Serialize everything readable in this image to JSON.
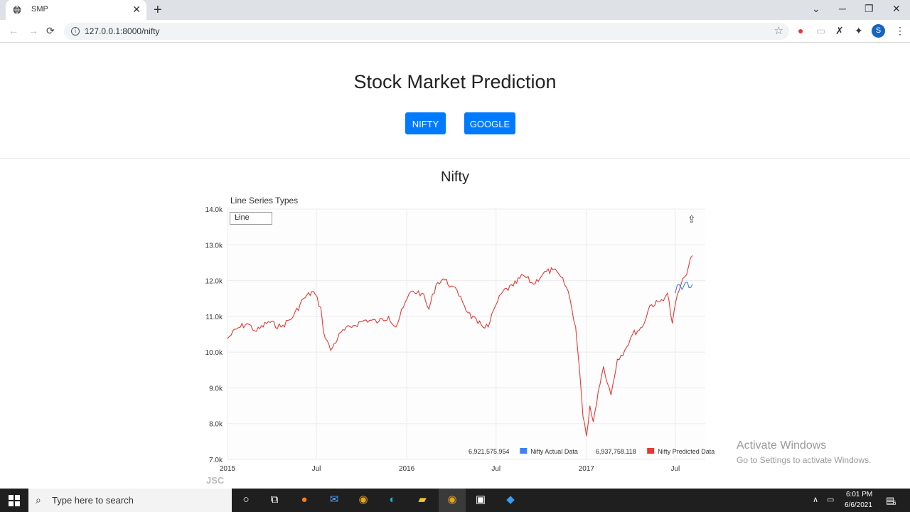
{
  "browser": {
    "tab_title": "SMP",
    "url": "127.0.0.1:8000/nifty",
    "profile_initial": "S"
  },
  "page": {
    "title": "Stock Market Prediction",
    "buttons": [
      "NIFTY",
      "GOOGLE"
    ]
  },
  "chart_controls": {
    "series_types_label": "Line Series Types",
    "series_type_value": "Line",
    "watermark": "JSC"
  },
  "chart_data": {
    "type": "line",
    "title": "Nifty",
    "xlabel": "",
    "ylabel": "",
    "x_range": [
      "2015-01-01",
      "2017-08-31"
    ],
    "ylim": [
      7000,
      14000
    ],
    "y_ticks": [
      "14.0k",
      "13.0k",
      "12.0k",
      "11.0k",
      "10.0k",
      "9.0k",
      "8.0k",
      "7.0k"
    ],
    "x_ticks": [
      {
        "date": "2015-01-01",
        "label": "2015"
      },
      {
        "date": "2015-07-01",
        "label": "Jul"
      },
      {
        "date": "2016-01-01",
        "label": "2016"
      },
      {
        "date": "2016-07-01",
        "label": "Jul"
      },
      {
        "date": "2017-01-01",
        "label": "2017"
      },
      {
        "date": "2017-07-01",
        "label": "Jul"
      }
    ],
    "grid": true,
    "legend_position": "bottom-right",
    "series": [
      {
        "name": "Nifty Predicted Data",
        "legend_value": "6,937,758.118",
        "color": "#e53935",
        "points": [
          [
            "2015-01-01",
            10380
          ],
          [
            "2015-01-20",
            10650
          ],
          [
            "2015-02-10",
            10800
          ],
          [
            "2015-03-01",
            10580
          ],
          [
            "2015-03-25",
            10850
          ],
          [
            "2015-04-20",
            10700
          ],
          [
            "2015-05-15",
            11000
          ],
          [
            "2015-06-05",
            11500
          ],
          [
            "2015-06-25",
            11700
          ],
          [
            "2015-07-10",
            11250
          ],
          [
            "2015-07-15",
            10600
          ],
          [
            "2015-07-30",
            10050
          ],
          [
            "2015-08-20",
            10550
          ],
          [
            "2015-09-15",
            10750
          ],
          [
            "2015-10-10",
            10900
          ],
          [
            "2015-11-05",
            10850
          ],
          [
            "2015-11-25",
            11000
          ],
          [
            "2015-12-10",
            10700
          ],
          [
            "2015-12-25",
            11250
          ],
          [
            "2016-01-10",
            11700
          ],
          [
            "2016-02-01",
            11650
          ],
          [
            "2016-02-15",
            11200
          ],
          [
            "2016-03-01",
            11900
          ],
          [
            "2016-03-15",
            12050
          ],
          [
            "2016-04-01",
            11850
          ],
          [
            "2016-04-20",
            11550
          ],
          [
            "2016-05-05",
            11100
          ],
          [
            "2016-05-25",
            10800
          ],
          [
            "2016-06-15",
            10700
          ],
          [
            "2016-06-30",
            11300
          ],
          [
            "2016-07-15",
            11700
          ],
          [
            "2016-08-05",
            11850
          ],
          [
            "2016-08-25",
            12150
          ],
          [
            "2016-09-15",
            11900
          ],
          [
            "2016-10-05",
            12200
          ],
          [
            "2016-10-25",
            12300
          ],
          [
            "2016-11-10",
            12100
          ],
          [
            "2016-11-25",
            11700
          ],
          [
            "2016-12-10",
            10700
          ],
          [
            "2016-12-18",
            9500
          ],
          [
            "2016-12-25",
            8200
          ],
          [
            "2017-01-01",
            7650
          ],
          [
            "2017-01-08",
            8500
          ],
          [
            "2017-01-15",
            8050
          ],
          [
            "2017-01-25",
            8900
          ],
          [
            "2017-02-05",
            9600
          ],
          [
            "2017-02-20",
            8800
          ],
          [
            "2017-03-05",
            9800
          ],
          [
            "2017-03-20",
            10050
          ],
          [
            "2017-04-05",
            10500
          ],
          [
            "2017-04-25",
            10700
          ],
          [
            "2017-05-10",
            11300
          ],
          [
            "2017-05-30",
            11400
          ],
          [
            "2017-06-15",
            11650
          ],
          [
            "2017-06-25",
            10800
          ],
          [
            "2017-07-05",
            11600
          ],
          [
            "2017-07-20",
            12100
          ],
          [
            "2017-08-05",
            12700
          ]
        ]
      },
      {
        "name": "Nifty Actual Data",
        "legend_value": "6,921,575.954",
        "color": "#3b82f6",
        "points": [
          [
            "2017-07-01",
            11650
          ],
          [
            "2017-07-08",
            11900
          ],
          [
            "2017-07-15",
            11750
          ],
          [
            "2017-07-22",
            11950
          ],
          [
            "2017-07-29",
            11800
          ],
          [
            "2017-08-05",
            11900
          ]
        ]
      }
    ]
  },
  "watermark_windows": {
    "line1": "Activate Windows",
    "line2": "Go to Settings to activate Windows."
  },
  "taskbar": {
    "search_placeholder": "Type here to search",
    "time": "6:01 PM",
    "date": "6/6/2021",
    "notification_count": "6"
  }
}
